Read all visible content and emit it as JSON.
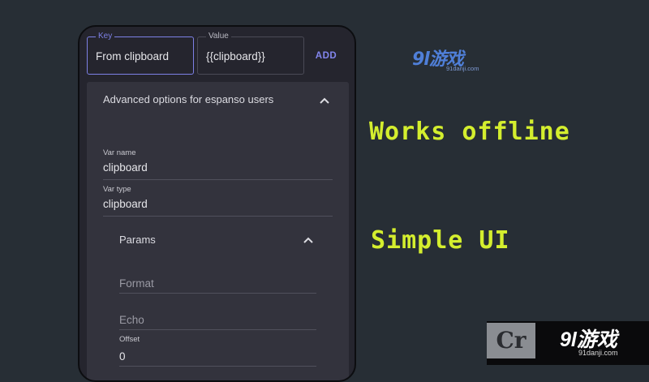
{
  "form": {
    "key_label": "Key",
    "key_value": "From clipboard",
    "value_label": "Value",
    "value_value": "{{clipboard}}",
    "add_label": "ADD"
  },
  "advanced": {
    "header": "Advanced options for espanso users",
    "var_name_label": "Var name",
    "var_name_value": "clipboard",
    "var_type_label": "Var type",
    "var_type_value": "clipboard",
    "params": {
      "header": "Params",
      "format_placeholder": "Format",
      "echo_placeholder": "Echo",
      "offset_label": "Offset",
      "offset_value": "0"
    }
  },
  "promo": {
    "line1": "Works offline",
    "line2": "Simple UI"
  },
  "watermarks": {
    "top_main": "9l游戏",
    "top_sub": "91danji.com",
    "bottom_cr": "Cr",
    "bottom_main": "9l游戏",
    "bottom_sub": "91danji.com"
  },
  "colors": {
    "accent": "#7d80e6",
    "promo_text": "#d4ee2e",
    "background": "#272e35",
    "panel": "#33333d"
  }
}
